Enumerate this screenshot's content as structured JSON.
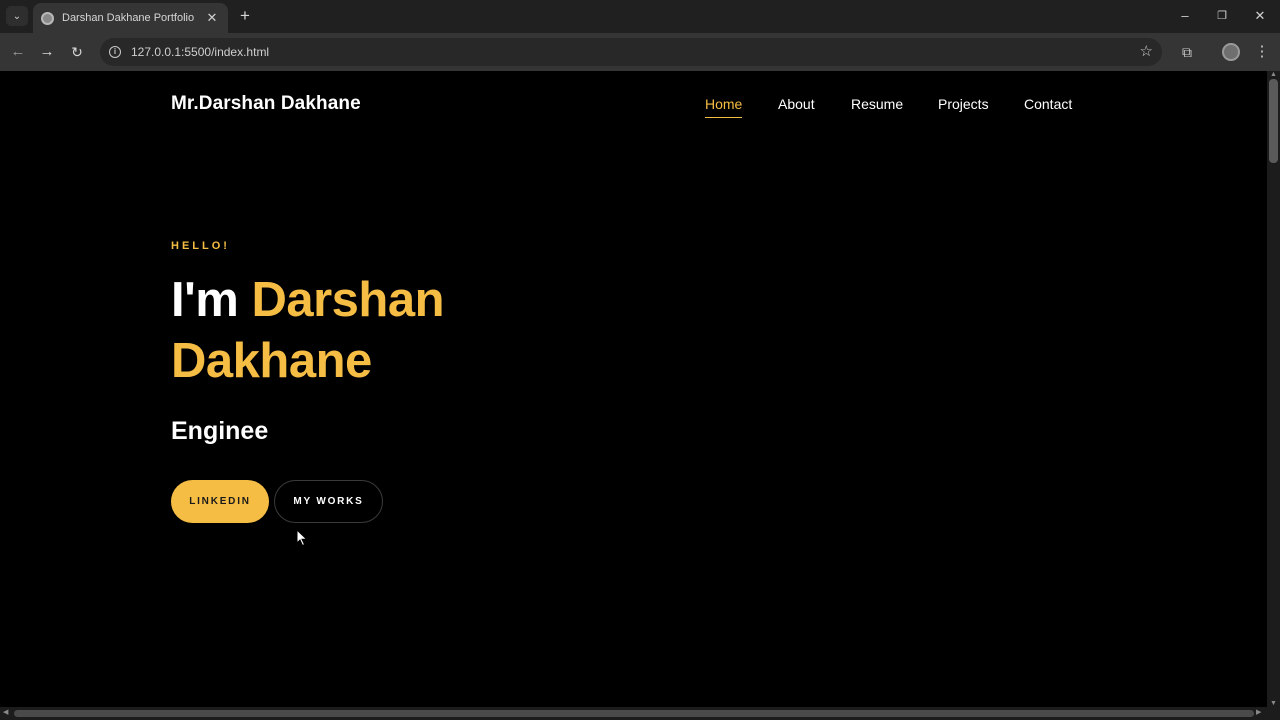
{
  "browser": {
    "tab_title": "Darshan Dakhane Portfolio",
    "url": "127.0.0.1:5500/index.html"
  },
  "site": {
    "logo": "Mr.Darshan Dakhane",
    "nav": [
      "Home",
      "About",
      "Resume",
      "Projects",
      "Contact"
    ],
    "active_nav": "Home"
  },
  "hero": {
    "greeting": "HELLO!",
    "title_prefix": "I'm ",
    "title_name_line1": "Darshan",
    "title_name_line2": "Dakhane",
    "role": "Enginee",
    "btn_primary": "LINKEDIN",
    "btn_secondary": "MY WORKS"
  },
  "colors": {
    "accent": "#f6bd44",
    "background": "#000000"
  }
}
